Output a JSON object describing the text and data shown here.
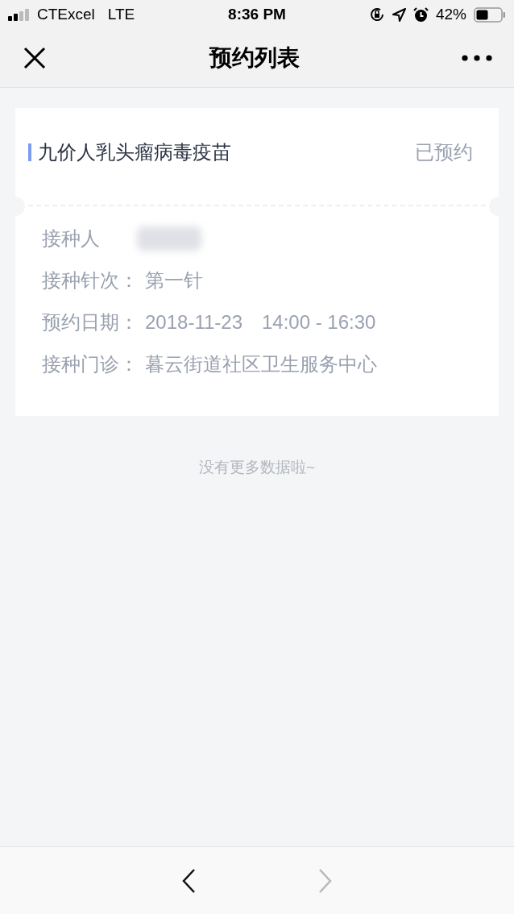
{
  "status_bar": {
    "carrier": "CTExcel",
    "network": "LTE",
    "time": "8:36 PM",
    "battery": "42%"
  },
  "nav_bar": {
    "title": "预约列表"
  },
  "appointments": [
    {
      "vaccine": "九价人乳头瘤病毒疫苗",
      "status": "已预约",
      "details": [
        {
          "label": "接种人",
          "redacted": true
        },
        {
          "label": "接种针次：",
          "value": "第一针",
          "redacted": false
        },
        {
          "label": "预约日期：",
          "value": "2018-11-23　14:00 - 16:30",
          "redacted": false
        },
        {
          "label": "接种门诊：",
          "value": "暮云街道社区卫生服务中心",
          "redacted": false
        }
      ]
    }
  ],
  "end_note": "没有更多数据啦~",
  "toolbar": {
    "back": {
      "disabled": false
    },
    "forward": {
      "disabled": true
    }
  }
}
